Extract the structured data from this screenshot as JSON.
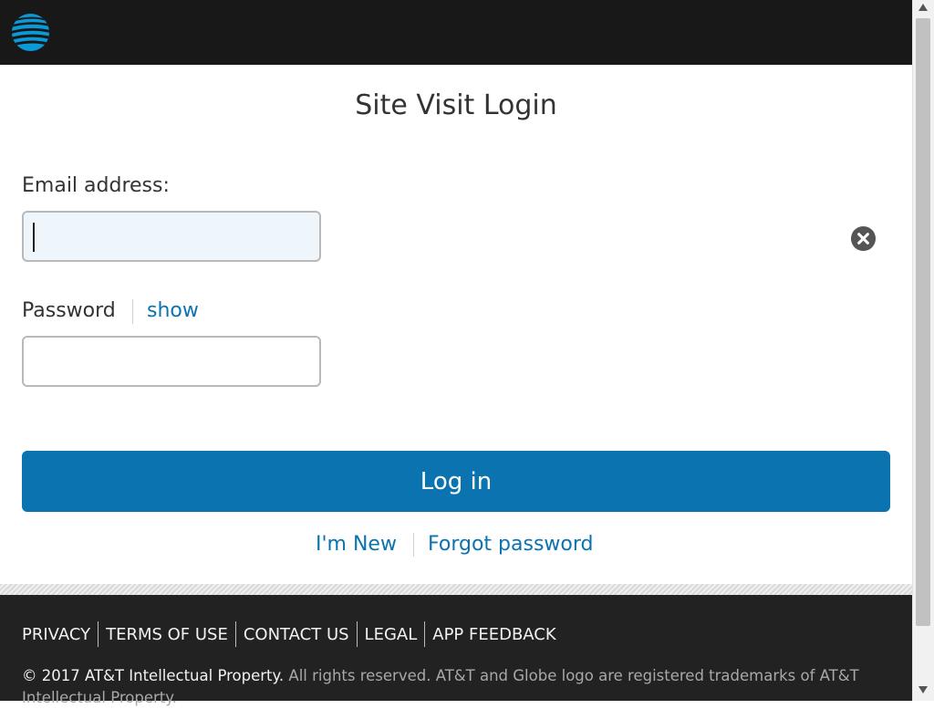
{
  "header": {
    "logo_icon": "att-globe-icon"
  },
  "login": {
    "title": "Site Visit Login",
    "email_label": "Email address:",
    "email_value": "",
    "email_clear_icon": "clear-circle-x-icon",
    "password_label": "Password",
    "show_label": "show",
    "password_value": "",
    "login_button": "Log in",
    "new_label": "I'm New",
    "forgot_label": "Forgot password"
  },
  "footer": {
    "links": [
      "PRIVACY",
      "TERMS OF USE",
      "CONTACT US",
      "LEGAL",
      "APP FEEDBACK"
    ],
    "copyright_strong": "© 2017 AT&T Intellectual Property.",
    "copyright_rest": " All rights reserved. AT&T and Globe logo are registered trademarks of AT&T Intellectual Property."
  },
  "colors": {
    "brand_blue": "#0a73b0",
    "header_bg": "#181818",
    "footer_bg": "#222222"
  }
}
